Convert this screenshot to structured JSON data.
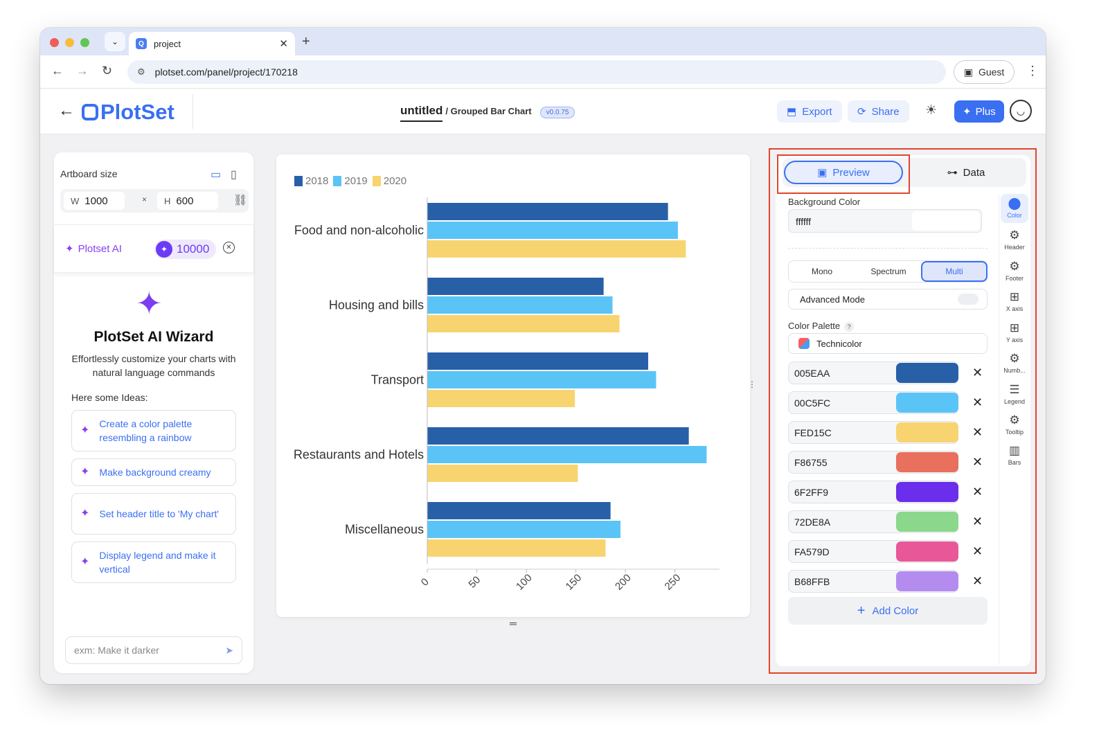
{
  "browser": {
    "tab_title": "project",
    "url": "plotset.com/panel/project/170218",
    "profile": "Guest"
  },
  "header": {
    "logo": "PlotSet",
    "project_title": "untitled",
    "chart_type": "/ Grouped Bar Chart",
    "version": "v0.0.75",
    "export_label": "Export",
    "share_label": "Share",
    "plus_label": "Plus"
  },
  "left_panel": {
    "artboard_label": "Artboard size",
    "width_label": "W",
    "width_value": "1000",
    "height_label": "H",
    "height_value": "600",
    "times": "×",
    "ai_name": "Plotset AI",
    "credits": "10000",
    "wizard_title": "PlotSet AI Wizard",
    "wizard_subtitle": "Effortlessly customize your charts with natural language commands",
    "ideas_label": "Here some Ideas:",
    "ideas": [
      "Create a color palette resembling a rainbow",
      "Make background creamy",
      "Set header title to 'My chart'",
      "Display legend and make it vertical"
    ],
    "prompt_placeholder": "exm: Make it darker"
  },
  "chart_data": {
    "type": "bar",
    "orientation": "horizontal",
    "categories": [
      "Food and non-alcoholic",
      "Housing and bills",
      "Transport",
      "Restaurants and Hotels",
      "Miscellaneous"
    ],
    "series": [
      {
        "name": "2018",
        "color": "#2860A8",
        "values": [
          243,
          178,
          223,
          264,
          185
        ]
      },
      {
        "name": "2019",
        "color": "#5BC4F7",
        "values": [
          253,
          187,
          231,
          282,
          195
        ]
      },
      {
        "name": "2020",
        "color": "#F8D470",
        "values": [
          261,
          194,
          149,
          152,
          180
        ]
      }
    ],
    "xlim": [
      0,
      295
    ],
    "xticks": [
      "0",
      "50",
      "100",
      "150",
      "200",
      "250"
    ],
    "tick_values": [
      0,
      50,
      100,
      150,
      200,
      250
    ],
    "legend": "top-left",
    "grid": false
  },
  "right_panel": {
    "tab_preview": "Preview",
    "tab_data": "Data",
    "bg_label": "Background Color",
    "bg_value": "ffffff",
    "modes": [
      "Mono",
      "Spectrum",
      "Multi"
    ],
    "active_mode": "Multi",
    "advanced_mode": "Advanced Mode",
    "palette_label": "Color Palette",
    "palette_help": "?",
    "palette_value": "Technicolor",
    "colors": [
      {
        "hex": "005EAA",
        "swatch": "#2860A8"
      },
      {
        "hex": "00C5FC",
        "swatch": "#5BC4F7"
      },
      {
        "hex": "FED15C",
        "swatch": "#F8D470"
      },
      {
        "hex": "F86755",
        "swatch": "#E8705C"
      },
      {
        "hex": "6F2FF9",
        "swatch": "#6A2EEC"
      },
      {
        "hex": "72DE8A",
        "swatch": "#8BD88C"
      },
      {
        "hex": "FA579D",
        "swatch": "#E85898"
      },
      {
        "hex": "B68FFB",
        "swatch": "#B48CF0"
      }
    ],
    "add_color": "Add Color",
    "side_nav": [
      "Color",
      "Header",
      "Footer",
      "X axis",
      "Y axis",
      "Numb...",
      "Legend",
      "Tooltip",
      "Bars"
    ]
  }
}
